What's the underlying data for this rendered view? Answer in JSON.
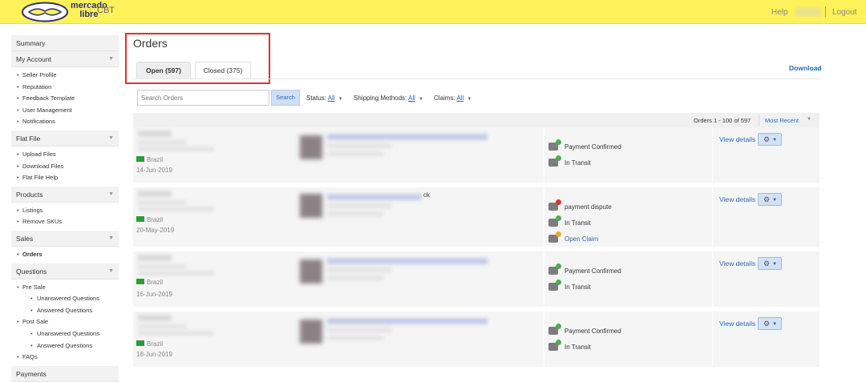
{
  "header": {
    "logo_text": "mercado libre",
    "logo_line1": "mercado",
    "logo_line2": "libre",
    "section": "CBT",
    "help": "Help",
    "logout": "Logout"
  },
  "sidebar": {
    "sections": [
      {
        "label": "Summary",
        "caret": false,
        "items": []
      },
      {
        "label": "My Account",
        "caret": true,
        "items": [
          {
            "label": "Seller Profile"
          },
          {
            "label": "Reputation"
          },
          {
            "label": "Feedback Template"
          },
          {
            "label": "User Management"
          },
          {
            "label": "Notifications"
          }
        ]
      },
      {
        "label": "Flat File",
        "caret": true,
        "items": [
          {
            "label": "Upload Files"
          },
          {
            "label": "Download Files"
          },
          {
            "label": "Flat File Help"
          }
        ]
      },
      {
        "label": "Products",
        "caret": true,
        "items": [
          {
            "label": "Listings"
          },
          {
            "label": "Remove SKUs"
          }
        ]
      },
      {
        "label": "Sales",
        "caret": true,
        "items": [
          {
            "label": "Orders",
            "active": true
          }
        ]
      },
      {
        "label": "Questions",
        "caret": true,
        "items": [
          {
            "label": "Pre Sale"
          },
          {
            "label": "Unanswered Questions",
            "sub": true
          },
          {
            "label": "Answered Questions",
            "sub": true
          },
          {
            "label": "Post Sale"
          },
          {
            "label": "Unanswered Questions",
            "sub": true
          },
          {
            "label": "Answered Questions",
            "sub": true
          },
          {
            "label": "FAQs"
          }
        ]
      },
      {
        "label": "Payments",
        "caret": false,
        "items": []
      }
    ]
  },
  "main": {
    "title": "Orders",
    "tabs": [
      {
        "label": "Open (597)"
      },
      {
        "label": "Closed (375)"
      }
    ],
    "download": "Download",
    "search": {
      "placeholder": "Search Orders",
      "button": "Search"
    },
    "filters": [
      {
        "label": "Status:",
        "value": "All"
      },
      {
        "label": "Shipping Methods:",
        "value": "All"
      },
      {
        "label": "Claims:",
        "value": "All"
      }
    ],
    "results": "Orders 1 - 100 of 597",
    "sort": "Most Recent",
    "view_details": "View details",
    "orders": [
      {
        "country": "Brazil",
        "date": "14-Jun-2019",
        "statuses": [
          {
            "text": "Payment Confirmed",
            "badge": "green"
          },
          {
            "text": "In Transit",
            "badge": "green"
          }
        ]
      },
      {
        "country": "Brazil",
        "date": "20-May-2019",
        "title_suffix": "ck",
        "statuses": [
          {
            "text": "payment dispute",
            "badge": "red"
          },
          {
            "text": "In Transit",
            "badge": "green"
          },
          {
            "text": "Open Claim",
            "badge": "orange",
            "link": true
          }
        ]
      },
      {
        "country": "Brazil",
        "date": "16-Jun-2019",
        "statuses": [
          {
            "text": "Payment Confirmed",
            "badge": "green"
          },
          {
            "text": "In Transit",
            "badge": "green"
          }
        ]
      },
      {
        "country": "Brazil",
        "date": "18-Jun-2019",
        "statuses": [
          {
            "text": "Payment Confirmed",
            "badge": "green"
          },
          {
            "text": "In Transit",
            "badge": "green"
          }
        ]
      }
    ]
  }
}
